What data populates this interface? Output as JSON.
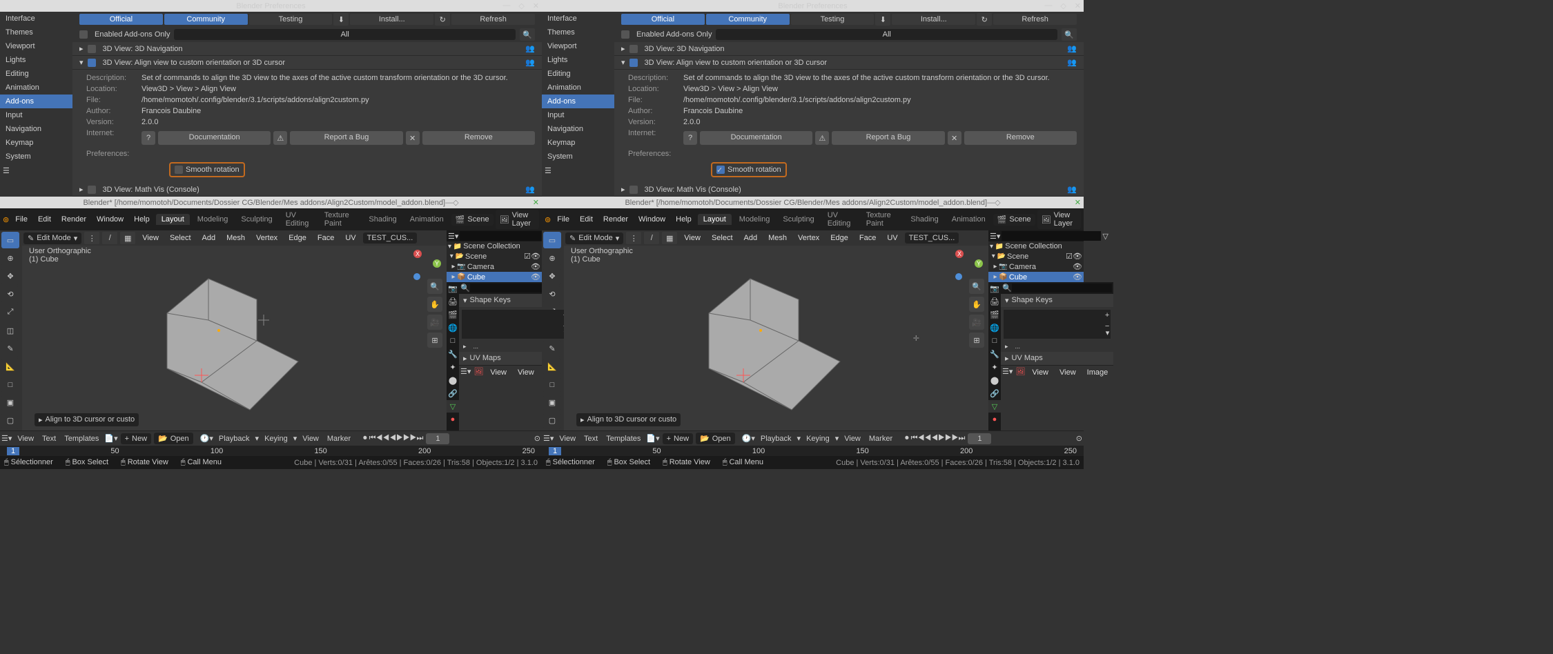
{
  "prefTitle": "Blender Preferences",
  "sideTabs": [
    "Interface",
    "Themes",
    "Viewport",
    "Lights",
    "Editing",
    "Animation",
    "Add-ons",
    "Input",
    "Navigation",
    "Keymap",
    "System"
  ],
  "sideActive": "Add-ons",
  "srcTabs": [
    "Official",
    "Community",
    "Testing"
  ],
  "install": "Install...",
  "refresh": "Refresh",
  "enabledOnly": "Enabled Add-ons Only",
  "all": "All",
  "addons": {
    "nav3d": "3D View: 3D Navigation",
    "align": "3D View: Align view to custom orientation or 3D cursor",
    "mathvis": "3D View: Math Vis (Console)"
  },
  "detail": {
    "descL": "Description:",
    "desc": "Set of commands to align the 3D view to the axes of the active custom transform orientation or the 3D cursor.",
    "locL": "Location:",
    "loc": "View3D > View > Align View",
    "fileL": "File:",
    "file": "/home/momotoh/.config/blender/3.1/scripts/addons/align2custom.py",
    "authL": "Author:",
    "auth": "Francois Daubine",
    "verL": "Version:",
    "ver": "2.0.0",
    "netL": "Internet:",
    "doc": "Documentation",
    "bug": "Report a Bug",
    "rem": "Remove",
    "prefL": "Preferences:",
    "smooth": "Smooth rotation"
  },
  "bTitle": "Blender* [/home/momotoh/Documents/Dossier CG/Blender/Mes addons/Align2Custom/model_addon.blend]",
  "topMenu": [
    "File",
    "Edit",
    "Render",
    "Window",
    "Help"
  ],
  "workspaces": [
    "Layout",
    "Modeling",
    "Sculpting",
    "UV Editing",
    "Texture Paint",
    "Shading",
    "Animation"
  ],
  "scene": "Scene",
  "viewLayer": "View Layer",
  "vpLabel1": "User Orthographic",
  "vpLabel2": "(1) Cube",
  "editMode": "Edit Mode",
  "vpMenu": [
    "View",
    "Select",
    "Add",
    "Mesh",
    "Vertex",
    "Edge",
    "Face",
    "UV"
  ],
  "orient": "TEST_CUS...",
  "alignHint": "Align to 3D cursor or custo",
  "outliner": {
    "sc": "Scene Collection",
    "col": "Scene",
    "cam": "Camera",
    "cube": "Cube"
  },
  "shapeKeys": "Shape Keys",
  "uvMaps": "UV Maps",
  "imgMenu": [
    "View",
    "View",
    "Image"
  ],
  "tlMenu": [
    "View",
    "Text",
    "Templates"
  ],
  "new": "New",
  "open": "Open",
  "tl2": [
    "Playback",
    "Keying",
    "View",
    "Marker"
  ],
  "frame": "1",
  "fstart": "1",
  "fend": "250",
  "ticks": [
    "50",
    "100",
    "150",
    "200",
    "250"
  ],
  "status": {
    "sel": "Sélectionner",
    "box": "Box Select",
    "rot": "Rotate View",
    "menu": "Call Menu",
    "stats": "Cube | Verts:0/31 | Arêtes:0/55 | Faces:0/26 | Tris:58 | Objects:1/2 | 3.1.0"
  }
}
